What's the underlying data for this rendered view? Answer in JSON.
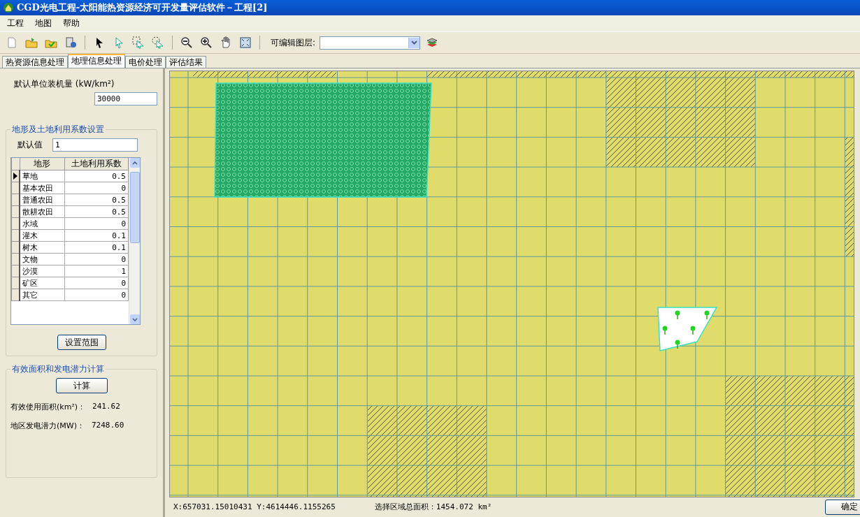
{
  "window": {
    "title": "CGD光电工程-太阳能热资源经济可开发量评估软件－工程[2]"
  },
  "menu": [
    "工程",
    "地图",
    "帮助"
  ],
  "toolbar": {
    "layer_label": "可编辑图层:"
  },
  "tabs": [
    {
      "label": "热资源信息处理",
      "selected": false
    },
    {
      "label": "地理信息处理",
      "selected": true
    },
    {
      "label": "电价处理",
      "selected": false
    },
    {
      "label": "评估结果",
      "selected": false
    }
  ],
  "panel": {
    "capacity_label": "默认单位装机量 (kW/km²)",
    "capacity_value": "30000",
    "terrain_group": {
      "title": "地形及土地利用系数设置",
      "default_label": "默认值",
      "default_value": "1",
      "columns": [
        "地形",
        "土地利用系数"
      ],
      "rows": [
        {
          "terrain": "草地",
          "factor": "0.5",
          "selected": true
        },
        {
          "terrain": "基本农田",
          "factor": "0",
          "selected": false
        },
        {
          "terrain": "普通农田",
          "factor": "0.5",
          "selected": false
        },
        {
          "terrain": "散耕农田",
          "factor": "0.5",
          "selected": false
        },
        {
          "terrain": "水域",
          "factor": "0",
          "selected": false
        },
        {
          "terrain": "灌木",
          "factor": "0.1",
          "selected": false
        },
        {
          "terrain": "树木",
          "factor": "0.1",
          "selected": false
        },
        {
          "terrain": "文物",
          "factor": "0",
          "selected": false
        },
        {
          "terrain": "沙漠",
          "factor": "1",
          "selected": false
        },
        {
          "terrain": "矿区",
          "factor": "0",
          "selected": false
        },
        {
          "terrain": "其它",
          "factor": "0",
          "selected": false
        }
      ],
      "button": "设置范围"
    },
    "calc_group": {
      "title": "有效面积和发电潜力计算",
      "button": "计算",
      "results": [
        {
          "label": "有效使用面积(km²)：",
          "value": "241.62"
        },
        {
          "label": "地区发电潜力(MW)：",
          "value": "7248.60"
        }
      ]
    }
  },
  "status_bar": {
    "coordinates": "X:657031.15010431 Y:4614446.1155265",
    "area": "选择区域总面积：1454.072 km²",
    "button": "确定"
  }
}
